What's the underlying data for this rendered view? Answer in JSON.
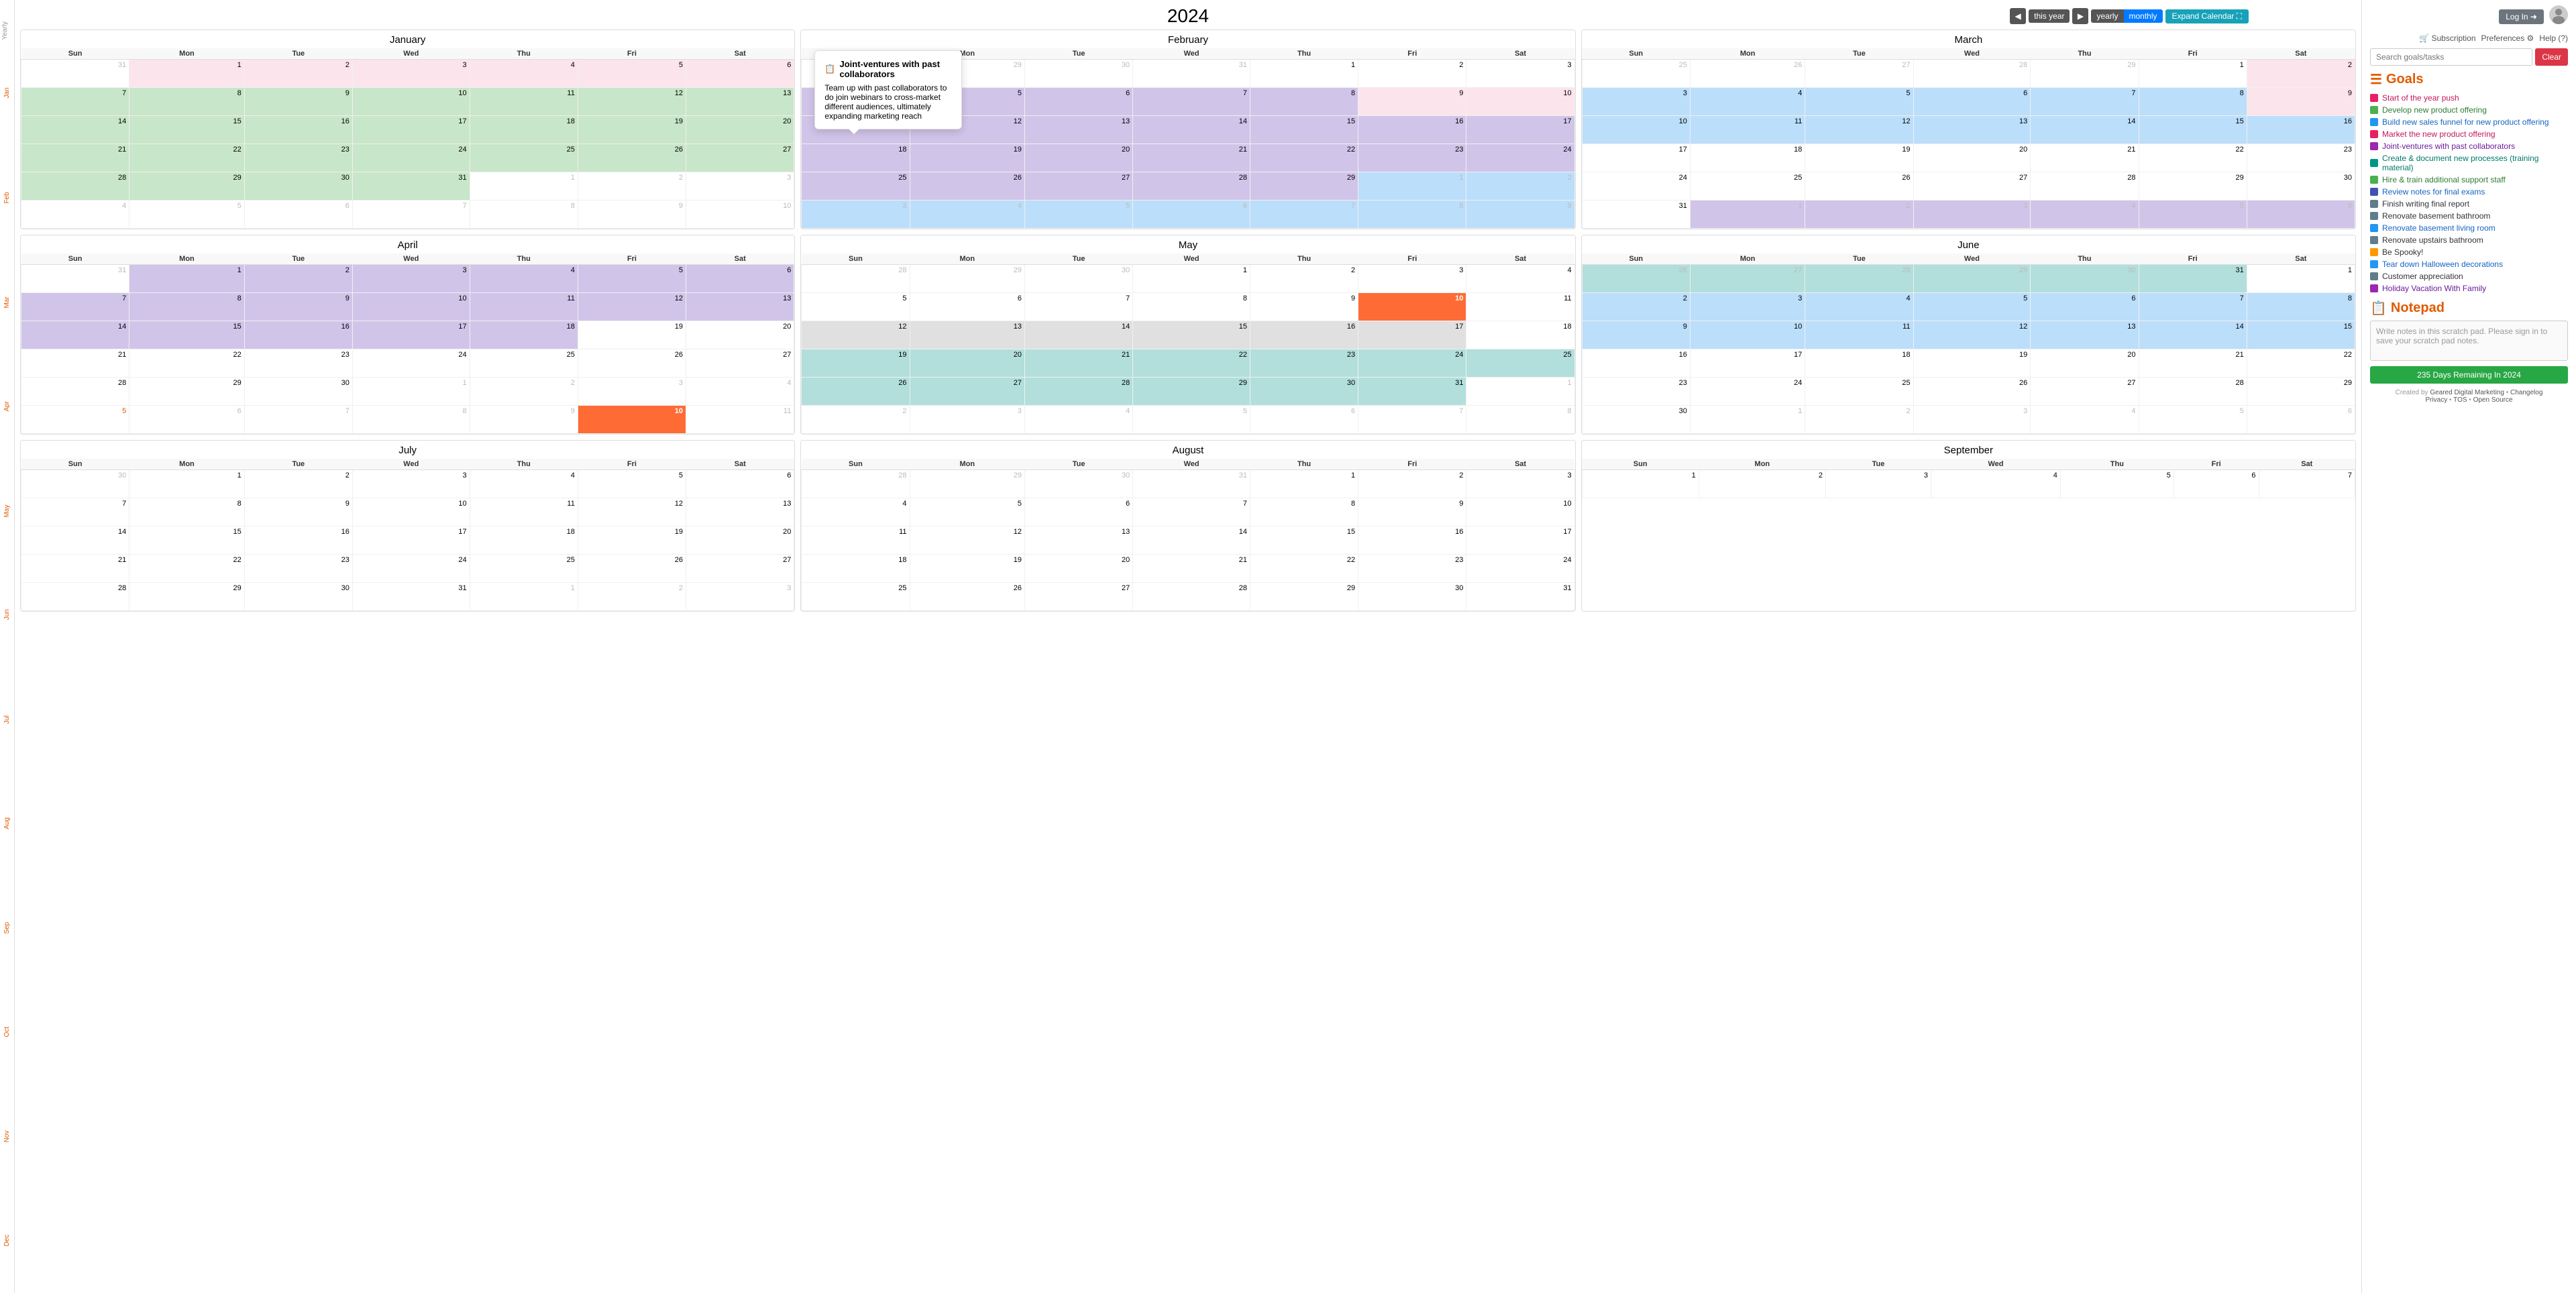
{
  "year": "2024",
  "nav": {
    "prev_label": "◀",
    "next_label": "▶",
    "this_year_label": "this year",
    "yearly_label": "yearly",
    "monthly_label": "monthly",
    "expand_label": "Expand Calendar ⛶"
  },
  "sidebar": {
    "login_label": "Log In ➜",
    "subscription_label": "🛒 Subscription",
    "preferences_label": "Preferences ⚙",
    "help_label": "Help (?)",
    "search_placeholder": "Search goals/tasks",
    "clear_label": "Clear",
    "goals_title": "Goals",
    "goals": [
      {
        "label": "Start of the year push",
        "color": "#e91e63",
        "text_class": "colored-pink"
      },
      {
        "label": "Develop new product offering",
        "color": "#4caf50",
        "text_class": "colored-green"
      },
      {
        "label": "Build new sales funnel for new product offering",
        "color": "#2196f3",
        "text_class": "colored-blue"
      },
      {
        "label": "Market the new product offering",
        "color": "#e91e63",
        "text_class": "colored-pink"
      },
      {
        "label": "Joint-ventures with past collaborators",
        "color": "#9c27b0",
        "text_class": "colored-purple"
      },
      {
        "label": "Create & document new processes (training material)",
        "color": "#009688",
        "text_class": "colored-teal"
      },
      {
        "label": "Hire & train additional support staff",
        "color": "#4caf50",
        "text_class": "colored-green"
      },
      {
        "label": "Review notes for final exams",
        "color": "#3f51b5",
        "text_class": "colored-blue"
      },
      {
        "label": "Finish writing final report",
        "color": "#607d8b",
        "text_class": ""
      },
      {
        "label": "Renovate basement bathroom",
        "color": "#607d8b",
        "text_class": ""
      },
      {
        "label": "Renovate basement living room",
        "color": "#2196f3",
        "text_class": "colored-blue"
      },
      {
        "label": "Renovate upstairs bathroom",
        "color": "#607d8b",
        "text_class": ""
      },
      {
        "label": "Be Spooky!",
        "color": "#ff9800",
        "text_class": ""
      },
      {
        "label": "Tear down Halloween decorations",
        "color": "#2196f3",
        "text_class": "colored-blue"
      },
      {
        "label": "Customer appreciation",
        "color": "#607d8b",
        "text_class": ""
      },
      {
        "label": "Holiday Vacation With Family",
        "color": "#9c27b0",
        "text_class": "colored-purple"
      }
    ],
    "notepad_title": "Notepad",
    "notepad_icon": "📋",
    "notepad_placeholder": "Write notes in this scratch pad.\nPlease sign in to save your scratch pad notes.",
    "days_remaining": "235 Days Remaining In 2024",
    "footer": "Created by Geared Digital Marketing • Changelog\nPrivacy • TOS • Open Source"
  },
  "month_labels": [
    "Jan",
    "Feb",
    "Mar",
    "Apr",
    "May",
    "Jun",
    "Jul",
    "Aug",
    "Sep",
    "Oct",
    "Nov",
    "Dec"
  ],
  "tooltip": {
    "title": "Joint-ventures with past collaborators",
    "icon": "📋",
    "description": "Team up with past collaborators to do join webinars to cross-market different audiences, ultimately expanding marketing reach"
  }
}
